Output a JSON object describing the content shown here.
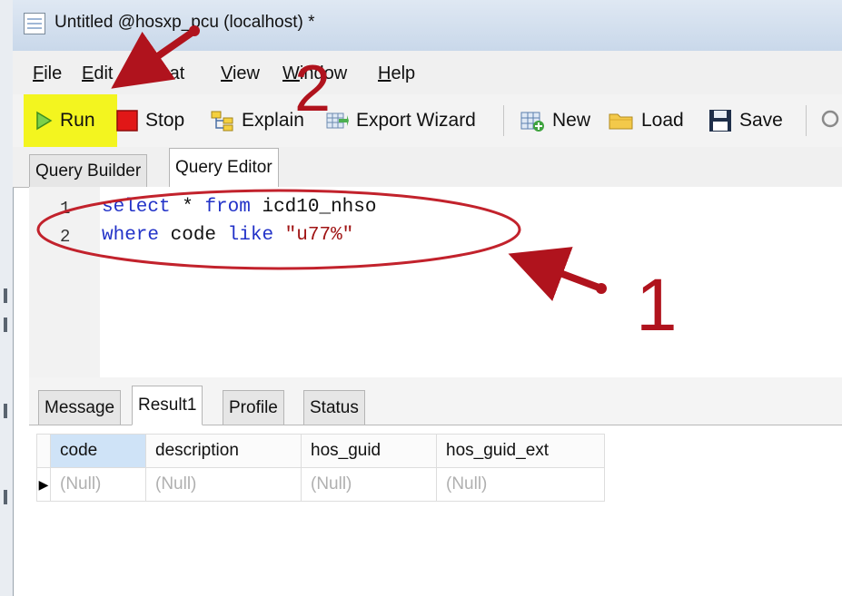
{
  "window": {
    "title": "Untitled @hosxp_pcu (localhost) *"
  },
  "menu": {
    "items": [
      "File",
      "Edit",
      "Format",
      "View",
      "Window",
      "Help"
    ]
  },
  "toolbar": {
    "run": "Run",
    "stop": "Stop",
    "explain": "Explain",
    "export_wizard": "Export Wizard",
    "new": "New",
    "load": "Load",
    "save": "Save"
  },
  "editor_tabs": {
    "query_builder": "Query Builder",
    "query_editor": "Query Editor",
    "active": "Query Editor"
  },
  "editor": {
    "lines": [
      {
        "number": "1",
        "kw1": "select",
        "mid": " * ",
        "kw2": "from",
        "rest": " icd10_nhso"
      },
      {
        "number": "2",
        "kw1": "where",
        "mid": " code ",
        "kw2": "like",
        "str": " \"u77%\""
      }
    ]
  },
  "result_tabs": {
    "message": "Message",
    "result1": "Result1",
    "profile": "Profile",
    "status": "Status",
    "active": "Result1"
  },
  "result_grid": {
    "columns": [
      "code",
      "description",
      "hos_guid",
      "hos_guid_ext"
    ],
    "rows": [
      [
        "(Null)",
        "(Null)",
        "(Null)",
        "(Null)"
      ]
    ]
  },
  "annotations": {
    "callout_1": "1",
    "callout_2": "2",
    "color": "#b0131d"
  },
  "colors": {
    "highlight": "#f3f51f",
    "keyword": "#2232c8",
    "string": "#a01414"
  },
  "icons": [
    "app-window-icon",
    "run-play-icon",
    "stop-square-icon",
    "explain-icon",
    "export-wizard-icon",
    "new-query-icon",
    "load-folder-icon",
    "save-disk-icon",
    "search-icon"
  ]
}
